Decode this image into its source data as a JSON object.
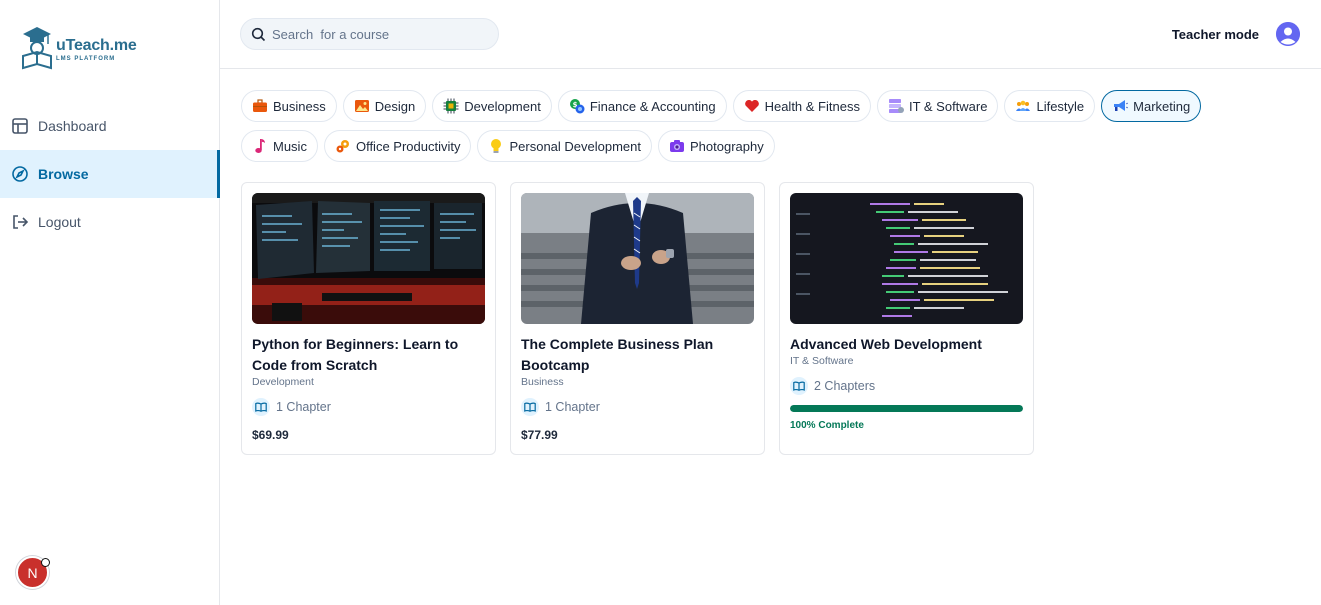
{
  "brand": {
    "title": "uTeach.me",
    "subtitle": "LMS PLATFORM"
  },
  "sidebar": {
    "items": [
      {
        "label": "Dashboard",
        "icon": "layout-icon",
        "active": false
      },
      {
        "label": "Browse",
        "icon": "compass-icon",
        "active": true
      },
      {
        "label": "Logout",
        "icon": "logout-icon",
        "active": false
      }
    ],
    "badge": "N"
  },
  "header": {
    "search_placeholder": "Search  for a course",
    "mode_label": "Teacher mode"
  },
  "categories": [
    {
      "label": "Business",
      "icon": "briefcase-icon"
    },
    {
      "label": "Design",
      "icon": "picture-icon"
    },
    {
      "label": "Development",
      "icon": "chip-icon"
    },
    {
      "label": "Finance & Accounting",
      "icon": "money-icon"
    },
    {
      "label": "Health & Fitness",
      "icon": "heart-icon"
    },
    {
      "label": "IT & Software",
      "icon": "server-icon"
    },
    {
      "label": "Lifestyle",
      "icon": "people-icon"
    },
    {
      "label": "Marketing",
      "icon": "megaphone-icon",
      "active": true
    },
    {
      "label": "Music",
      "icon": "music-note-icon"
    },
    {
      "label": "Office Productivity",
      "icon": "gears-icon"
    },
    {
      "label": "Personal Development",
      "icon": "lightbulb-icon"
    },
    {
      "label": "Photography",
      "icon": "camera-icon"
    }
  ],
  "courses": [
    {
      "title": "Python for Beginners: Learn to Code from Scratch",
      "category": "Development",
      "chapters": "1 Chapter",
      "price": "$69.99",
      "thumb": "monitors-photo"
    },
    {
      "title": "The Complete Business Plan Bootcamp",
      "category": "Business",
      "chapters": "1 Chapter",
      "price": "$77.99",
      "thumb": "suit-photo"
    },
    {
      "title": "Advanced Web Development",
      "category": "IT & Software",
      "chapters": "2 Chapters",
      "progress": 1.0,
      "progress_label": "100% Complete",
      "thumb": "code-photo"
    }
  ],
  "colors": {
    "accent": "#0369a1",
    "progress": "#047857",
    "brand": "#2b6e8f"
  }
}
